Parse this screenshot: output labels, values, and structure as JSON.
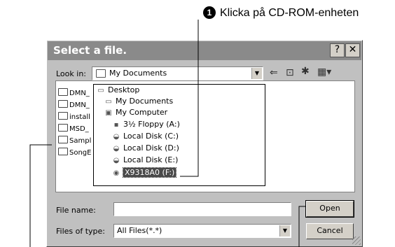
{
  "annotation": {
    "number": "1",
    "text": "Klicka på CD-ROM-enheten"
  },
  "dialog": {
    "title": "Select a file.",
    "title_buttons": {
      "help": "?",
      "close": "✕"
    },
    "look_in_label": "Look in:",
    "look_in_value": "My Documents",
    "toolbar_icons": [
      "back-icon",
      "up-folder-icon",
      "new-folder-icon",
      "view-menu-icon"
    ],
    "files": [
      "DMN_",
      "DMN_",
      "install",
      "MSD_",
      "Sampl",
      "SongE"
    ],
    "dropdown": [
      {
        "label": "Desktop",
        "icon": "desktop-icon"
      },
      {
        "label": "My Documents",
        "icon": "folder-icon"
      },
      {
        "label": "My Computer",
        "icon": "computer-icon"
      },
      {
        "label": "3½ Floppy (A:)",
        "icon": "floppy-icon"
      },
      {
        "label": "Local Disk (C:)",
        "icon": "disk-icon"
      },
      {
        "label": "Local Disk (D:)",
        "icon": "disk-icon"
      },
      {
        "label": "Local Disk (E:)",
        "icon": "disk-icon"
      },
      {
        "label": "X9318A0 (F:)",
        "icon": "cdrom-icon",
        "selected": true
      }
    ],
    "file_name_label": "File name:",
    "file_name_value": "",
    "files_of_type_label": "Files of type:",
    "files_of_type_value": "All Files(*.*)",
    "open_button": "Open",
    "cancel_button": "Cancel"
  }
}
